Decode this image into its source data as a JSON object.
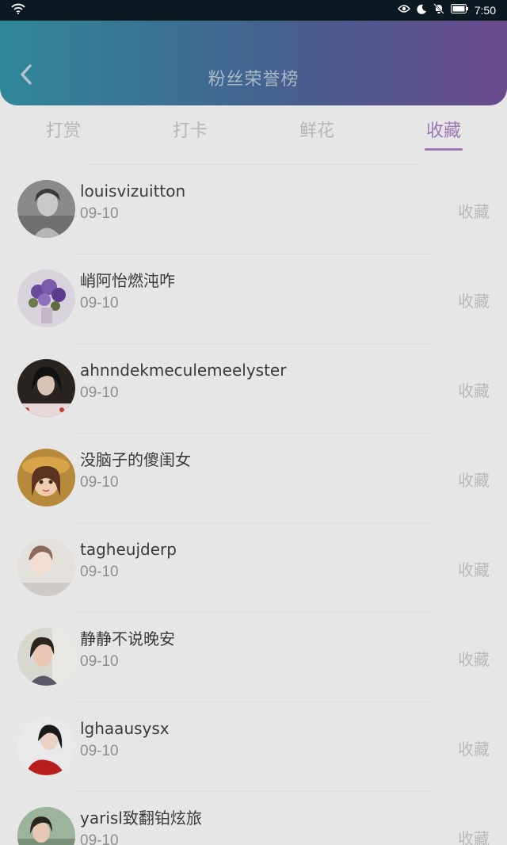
{
  "status_bar": {
    "time": "7:50"
  },
  "header": {
    "title": "粉丝荣誉榜"
  },
  "tabs": [
    {
      "label": "打赏",
      "active": false
    },
    {
      "label": "打卡",
      "active": false
    },
    {
      "label": "鲜花",
      "active": false
    },
    {
      "label": "收藏",
      "active": true
    }
  ],
  "list": [
    {
      "name": "louisvizuitton",
      "date": "09-10",
      "action": "收藏",
      "avatar": "grayscale-portrait"
    },
    {
      "name": "峭阿怡燃沌咋",
      "date": "09-10",
      "action": "收藏",
      "avatar": "purple-flowers"
    },
    {
      "name": "ahnndekmeculemeelyster",
      "date": "09-10",
      "action": "收藏",
      "avatar": "dark-hair-portrait"
    },
    {
      "name": "没脑子的傻闺女",
      "date": "09-10",
      "action": "收藏",
      "avatar": "cartoon-girl"
    },
    {
      "name": "tagheujderp",
      "date": "09-10",
      "action": "收藏",
      "avatar": "light-portrait"
    },
    {
      "name": "静静不说晚安",
      "date": "09-10",
      "action": "收藏",
      "avatar": "girl-portrait"
    },
    {
      "name": "lghaausysx",
      "date": "09-10",
      "action": "收藏",
      "avatar": "red-dress-portrait"
    },
    {
      "name": "yarisl致翻铂炫旅",
      "date": "09-10",
      "action": "收藏",
      "avatar": "outdoor-portrait"
    }
  ],
  "colors": {
    "accent": "#9a79b3",
    "header_gradient_start": "#2f8798",
    "header_gradient_end": "#6a4a8c"
  }
}
